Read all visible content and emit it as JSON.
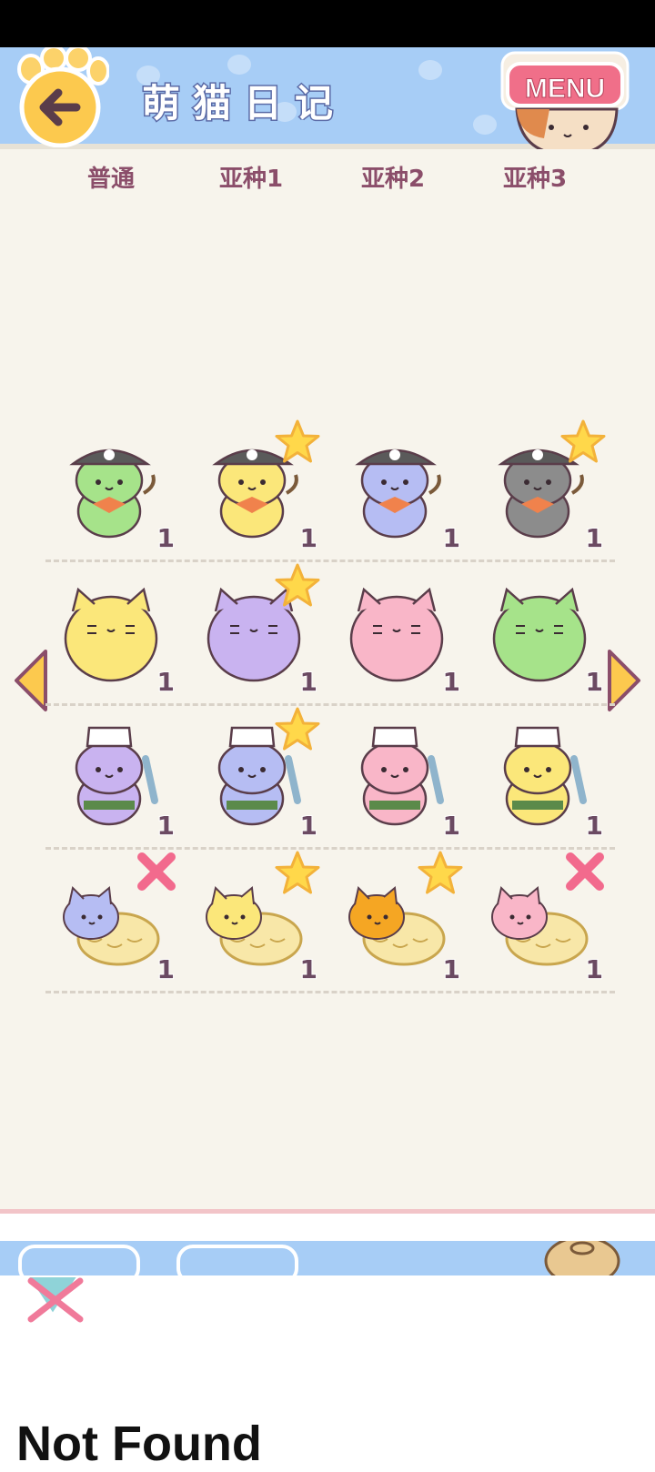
{
  "header": {
    "title": "萌猫日记",
    "menu_label": "MENU"
  },
  "tabs": [
    {
      "label": "普通"
    },
    {
      "label": "亚种1"
    },
    {
      "label": "亚种2"
    },
    {
      "label": "亚种3"
    }
  ],
  "grid": {
    "rows": [
      {
        "theme": "pirate",
        "cells": [
          {
            "color": "#a6e38a",
            "badge": "none",
            "count": "1"
          },
          {
            "color": "#fbe77a",
            "badge": "star",
            "count": "1"
          },
          {
            "color": "#b6bdf3",
            "badge": "none",
            "count": "1"
          },
          {
            "color": "#8c8c8c",
            "badge": "star",
            "count": "1"
          }
        ]
      },
      {
        "theme": "chubby",
        "cells": [
          {
            "color": "#fbe77a",
            "badge": "none",
            "count": "1"
          },
          {
            "color": "#c9b3f0",
            "badge": "star",
            "count": "1"
          },
          {
            "color": "#f9b6c8",
            "badge": "none",
            "count": "1"
          },
          {
            "color": "#a6e38a",
            "badge": "none",
            "count": "1"
          }
        ]
      },
      {
        "theme": "chef",
        "cells": [
          {
            "color": "#c9b3f0",
            "badge": "none",
            "count": "1"
          },
          {
            "color": "#b6bdf3",
            "badge": "star",
            "count": "1"
          },
          {
            "color": "#f9b6c8",
            "badge": "none",
            "count": "1"
          },
          {
            "color": "#fbe77a",
            "badge": "none",
            "count": "1"
          }
        ]
      },
      {
        "theme": "tempura",
        "cells": [
          {
            "color": "#b6bdf3",
            "badge": "cross",
            "count": "1"
          },
          {
            "color": "#fbe77a",
            "badge": "star",
            "count": "1"
          },
          {
            "color": "#f5a623",
            "badge": "star",
            "count": "1"
          },
          {
            "color": "#f9b6c8",
            "badge": "cross",
            "count": "1"
          }
        ]
      }
    ]
  },
  "footer": {
    "error_text": "Not Found"
  },
  "colors": {
    "header_bg": "#a7cdf6",
    "content_bg": "#f7f4ec",
    "tab_text": "#8b4e6a",
    "star": "#ffd84a",
    "cross": "#f26a8d"
  }
}
